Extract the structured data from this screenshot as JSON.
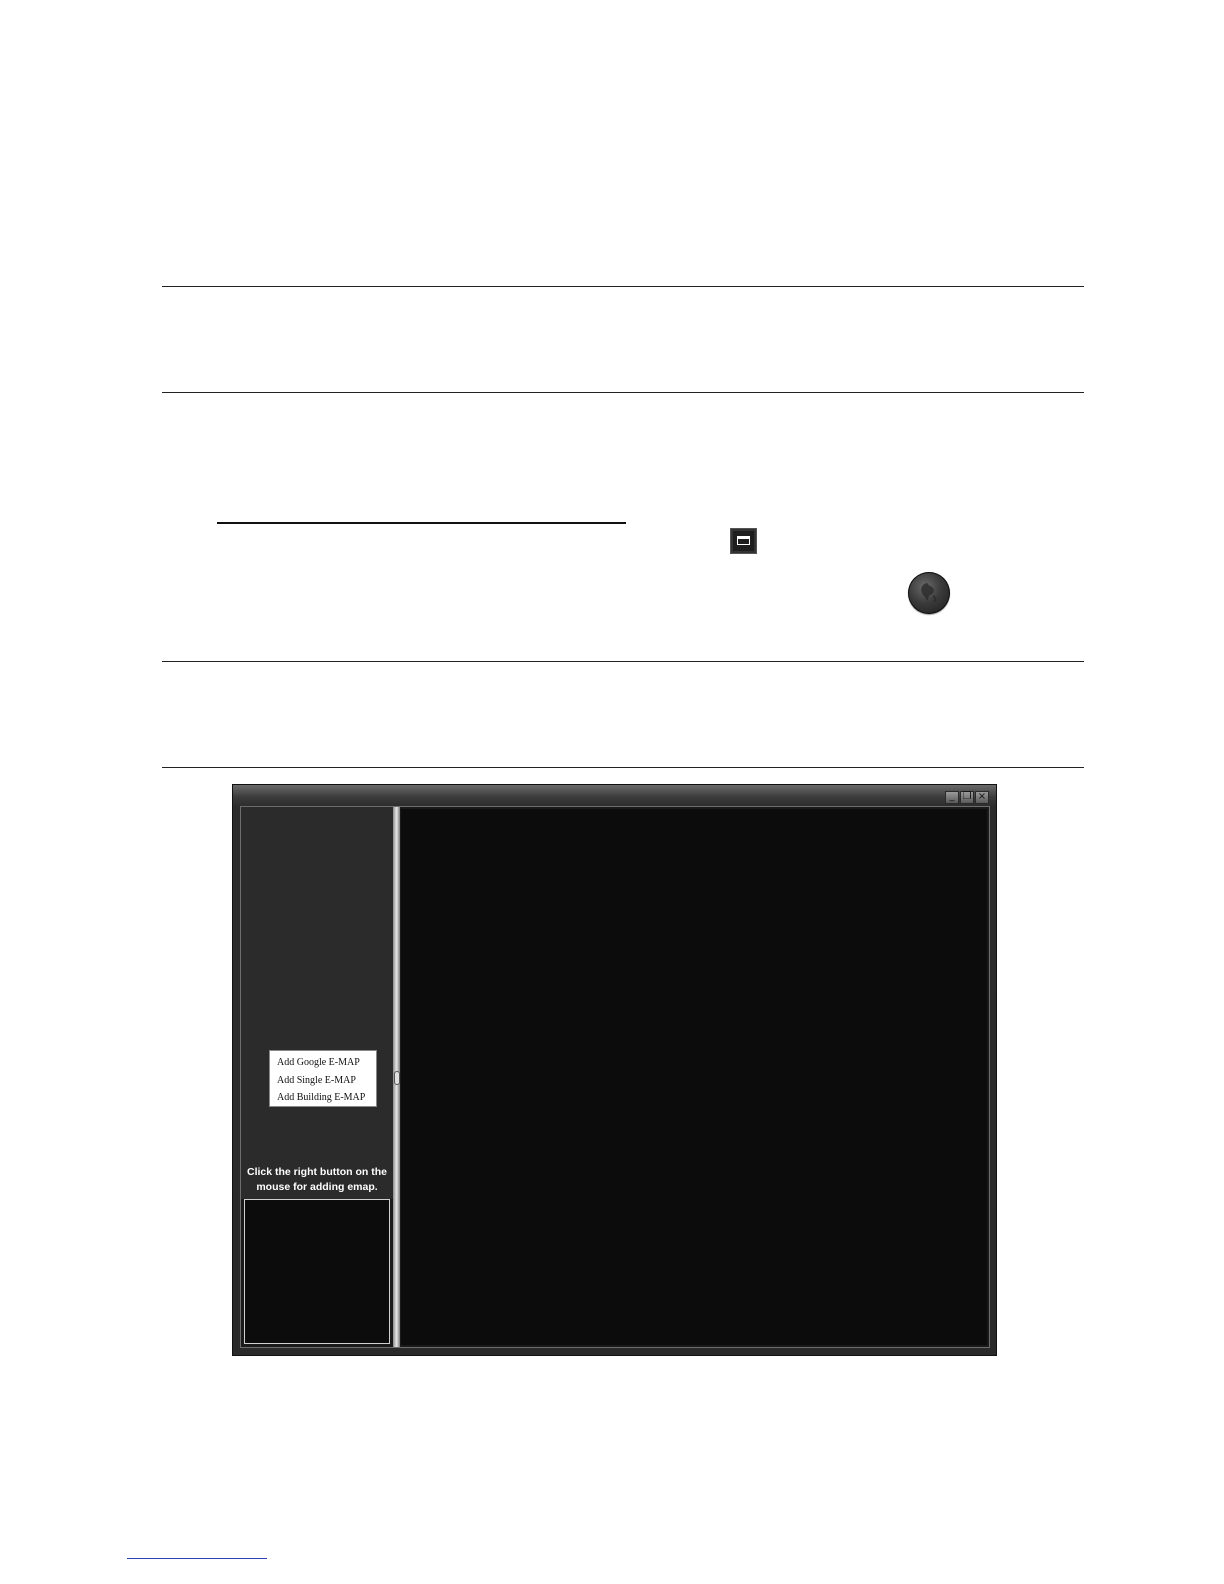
{
  "app": {
    "context_menu": {
      "items": [
        "Add Google E-MAP",
        "Add Single E-MAP",
        "Add Building E-MAP"
      ]
    },
    "hint_line1": "Click the right button on the",
    "hint_line2": "mouse for adding emap."
  },
  "icons": {
    "window_toggle": "window-icon",
    "emap": "emap-globe-icon",
    "minimize": "minimize-icon",
    "restore": "restore-icon",
    "close": "close-icon"
  }
}
